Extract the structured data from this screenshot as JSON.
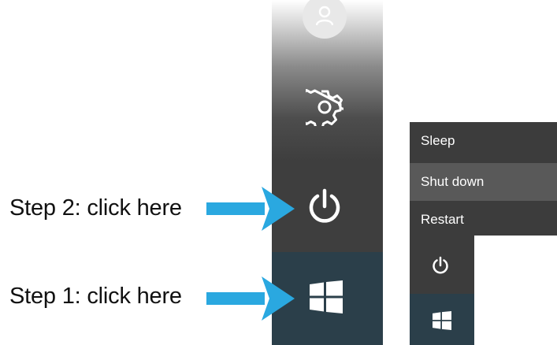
{
  "annotations": {
    "step2": "Step 2: click here",
    "step1": "Step 1: click here"
  },
  "power_menu": {
    "items": [
      {
        "label": "Sleep"
      },
      {
        "label": "Shut down",
        "highlighted": true
      },
      {
        "label": "Restart"
      }
    ]
  },
  "icons": {
    "bar": [
      "user-icon",
      "gear-icon",
      "power-icon",
      "windows-icon"
    ],
    "menu": [
      "power-icon",
      "windows-icon"
    ]
  },
  "colors": {
    "arrow": "#2aa8e0",
    "bar_dark": "#3e3e3e",
    "start_tile": "#2b3f4a",
    "menu_bg": "#3c3c3c",
    "menu_highlight": "#595959"
  }
}
